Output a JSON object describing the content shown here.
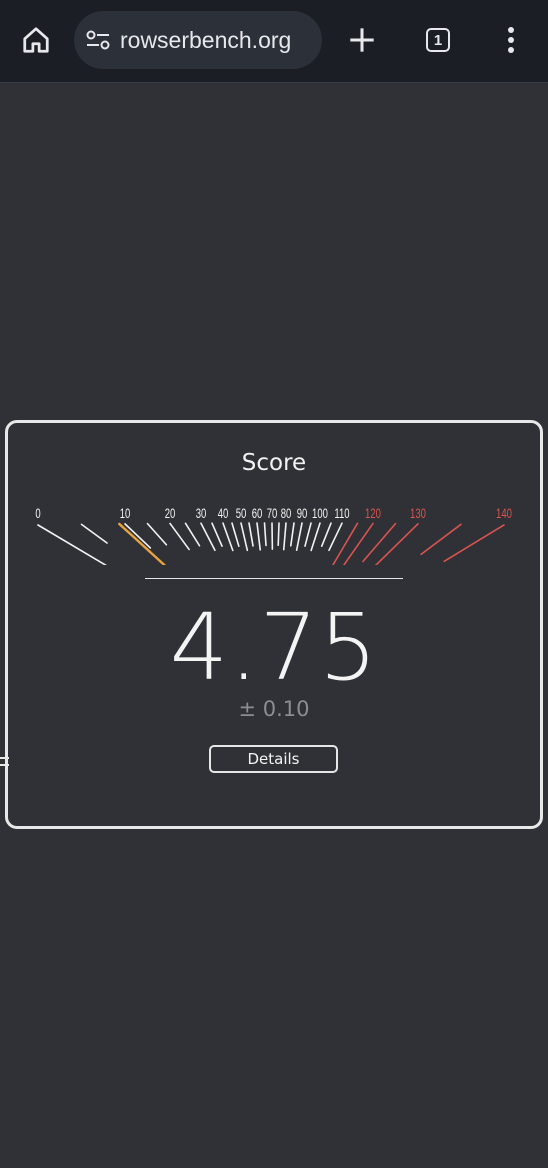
{
  "browser": {
    "url": "rowserbench.org",
    "tab_count": "1",
    "icons": [
      "home-icon",
      "site-settings-icon",
      "plus-icon",
      "tab-switcher-icon",
      "more-vert-icon"
    ]
  },
  "score": {
    "title": "Score",
    "value": "4.75",
    "error": "± 0.10",
    "details_label": "Details",
    "gauge_labels": {
      "normal": [
        "0",
        "10",
        "20",
        "30",
        "40",
        "50",
        "60",
        "70",
        "80",
        "90",
        "100",
        "110"
      ],
      "high": [
        "120",
        "130",
        "140"
      ]
    },
    "gauge_value": 4.75
  },
  "colors": {
    "background": "#2f3136",
    "toolbar": "#1b1e25",
    "tick": "#f2f2f2",
    "needle": "#e8a33d",
    "high_range": "#d9534f",
    "muted_text": "#8a8d93"
  }
}
